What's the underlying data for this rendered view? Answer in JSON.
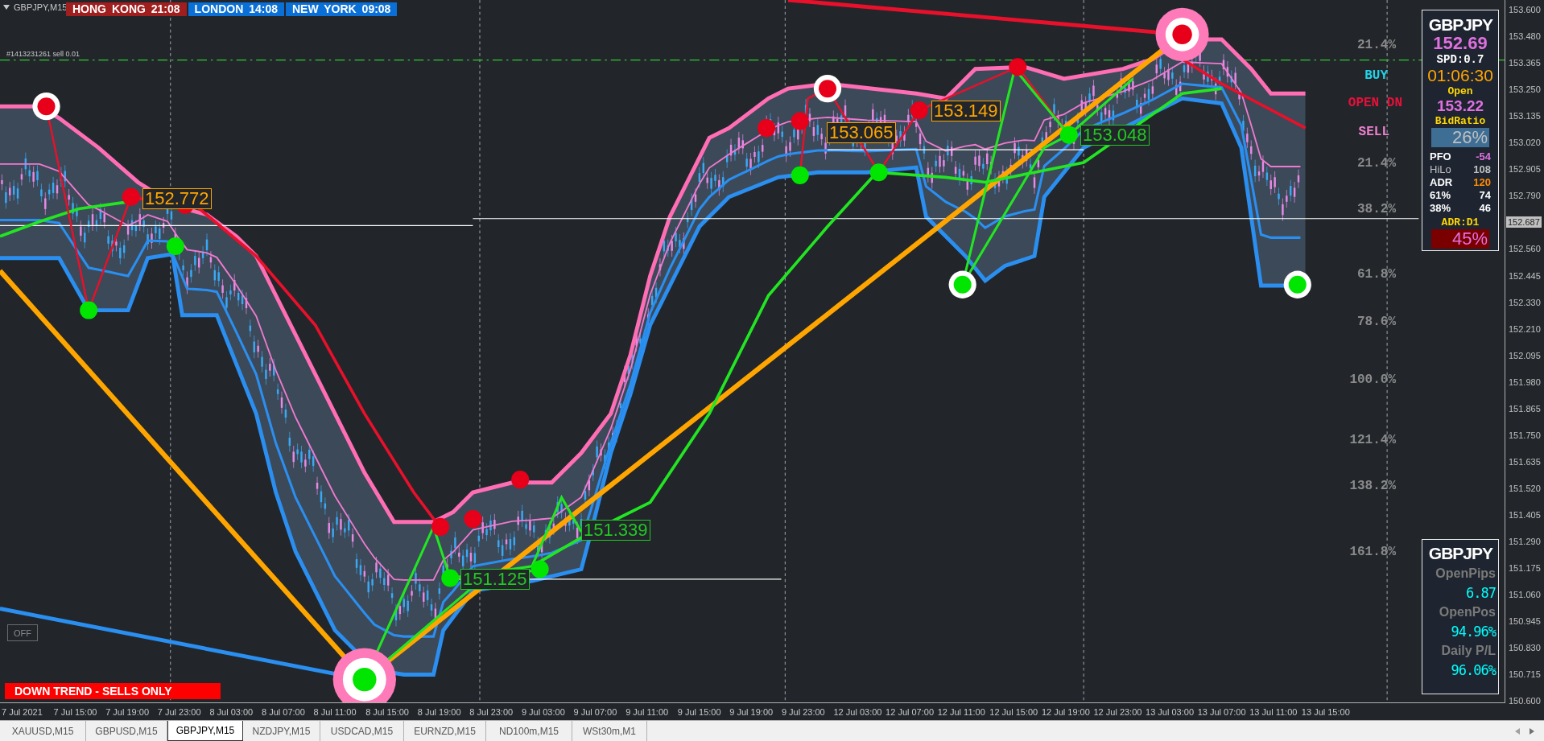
{
  "chart_header": {
    "symbol": "GBPJPY,M15"
  },
  "sessions": [
    {
      "text": "HONG KONG 21:08",
      "color": "#a01e1e"
    },
    {
      "text": "LONDON 14:08",
      "color": "#0a6fd6"
    },
    {
      "text": "NEW YORK 09:08",
      "color": "#0a6fd6"
    }
  ],
  "order_label": "#1413231261 sell 0.01",
  "price_labels": [
    {
      "text": "152.772",
      "color": "#ffa500"
    },
    {
      "text": "153.065",
      "color": "#ffa500"
    },
    {
      "text": "153.149",
      "color": "#ffa500"
    },
    {
      "text": "153.048",
      "color": "#22c822"
    },
    {
      "text": "151.339",
      "color": "#22c822"
    },
    {
      "text": "151.125",
      "color": "#22c822"
    }
  ],
  "fib_levels": [
    {
      "text": "21.4%",
      "color": "#8a8a8a"
    },
    {
      "text": "BUY",
      "color": "#22d3e6"
    },
    {
      "text": "OPEN DN",
      "color": "#e8103a"
    },
    {
      "text": "SELL",
      "color": "#f080d0"
    },
    {
      "text": "21.4%",
      "color": "#8a8a8a"
    },
    {
      "text": "38.2%",
      "color": "#8a8a8a"
    },
    {
      "text": "61.8%",
      "color": "#8a8a8a"
    },
    {
      "text": "78.6%",
      "color": "#8a8a8a"
    },
    {
      "text": "100.0%",
      "color": "#8a8a8a"
    },
    {
      "text": "121.4%",
      "color": "#8a8a8a"
    },
    {
      "text": "138.2%",
      "color": "#8a8a8a"
    },
    {
      "text": "161.8%",
      "color": "#8a8a8a"
    }
  ],
  "off_button": "OFF",
  "trend_banner": "DOWN TREND - SELLS ONLY",
  "info_panel": {
    "symbol": "GBPJPY",
    "bid": "152.69",
    "spread": "SPD:0.7",
    "countdown": "01:06:30",
    "open_label": "Open",
    "open_price": "153.22",
    "bid_ratio_label": "BidRatio",
    "bid_ratio": "26%",
    "stats": [
      {
        "label": "PFO",
        "value": "-54",
        "color": "#e070e0",
        "dim": false
      },
      {
        "label": "HiLo",
        "value": "108",
        "color": "#c0c0c0",
        "dim": true
      },
      {
        "label": "ADR",
        "value": "120",
        "color": "#ff8c00",
        "dim": false
      },
      {
        "label": "61%",
        "value": "74",
        "color": "#ffffff",
        "dim": false
      },
      {
        "label": "38%",
        "value": "46",
        "color": "#ffffff",
        "dim": false
      }
    ],
    "adr_label": "ADR:D1",
    "adr_percent": "45%"
  },
  "positions_panel": {
    "symbol": "GBPJPY",
    "items": [
      {
        "label": "OpenPips",
        "value": "6.87"
      },
      {
        "label": "OpenPos",
        "value": "94.96%"
      },
      {
        "label": "Daily P/L",
        "value": "96.06%"
      }
    ]
  },
  "price_axis": [
    {
      "text": "153.600",
      "kind": "tick"
    },
    {
      "text": "153.480",
      "kind": "tick"
    },
    {
      "text": "153.365",
      "kind": "tick"
    },
    {
      "text": "153.250",
      "kind": "tick"
    },
    {
      "text": "153.135",
      "kind": "tick"
    },
    {
      "text": "153.020",
      "kind": "tick"
    },
    {
      "text": "152.905",
      "kind": "tick"
    },
    {
      "text": "152.790",
      "kind": "tick"
    },
    {
      "text": "152.687",
      "kind": "current"
    },
    {
      "text": "152.560",
      "kind": "tick"
    },
    {
      "text": "152.445",
      "kind": "tick"
    },
    {
      "text": "152.330",
      "kind": "tick"
    },
    {
      "text": "152.210",
      "kind": "tick"
    },
    {
      "text": "152.095",
      "kind": "tick"
    },
    {
      "text": "151.980",
      "kind": "tick"
    },
    {
      "text": "151.865",
      "kind": "tick"
    },
    {
      "text": "151.750",
      "kind": "tick"
    },
    {
      "text": "151.635",
      "kind": "tick"
    },
    {
      "text": "151.520",
      "kind": "tick"
    },
    {
      "text": "151.405",
      "kind": "tick"
    },
    {
      "text": "151.290",
      "kind": "tick"
    },
    {
      "text": "151.175",
      "kind": "tick"
    },
    {
      "text": "151.060",
      "kind": "tick"
    },
    {
      "text": "150.945",
      "kind": "tick"
    },
    {
      "text": "150.830",
      "kind": "tick"
    },
    {
      "text": "150.715",
      "kind": "tick"
    },
    {
      "text": "150.600",
      "kind": "tick"
    }
  ],
  "time_axis": [
    "7 Jul 2021",
    "7 Jul 15:00",
    "7 Jul 19:00",
    "7 Jul 23:00",
    "8 Jul 03:00",
    "8 Jul 07:00",
    "8 Jul 11:00",
    "8 Jul 15:00",
    "8 Jul 19:00",
    "8 Jul 23:00",
    "9 Jul 03:00",
    "9 Jul 07:00",
    "9 Jul 11:00",
    "9 Jul 15:00",
    "9 Jul 19:00",
    "9 Jul 23:00",
    "12 Jul 03:00",
    "12 Jul 07:00",
    "12 Jul 11:00",
    "12 Jul 15:00",
    "12 Jul 19:00",
    "12 Jul 23:00",
    "13 Jul 03:00",
    "13 Jul 07:00",
    "13 Jul 11:00",
    "13 Jul 15:00"
  ],
  "tabs": [
    {
      "label": "XAUUSD,M15",
      "selected": false
    },
    {
      "label": "GBPUSD,M15",
      "selected": false
    },
    {
      "label": "GBPJPY,M15",
      "selected": true
    },
    {
      "label": "NZDJPY,M15",
      "selected": false
    },
    {
      "label": "USDCAD,M15",
      "selected": false
    },
    {
      "label": "EURNZD,M15",
      "selected": false
    },
    {
      "label": "ND100m,M15",
      "selected": false
    },
    {
      "label": "WSt30m,M1",
      "selected": false
    }
  ]
}
